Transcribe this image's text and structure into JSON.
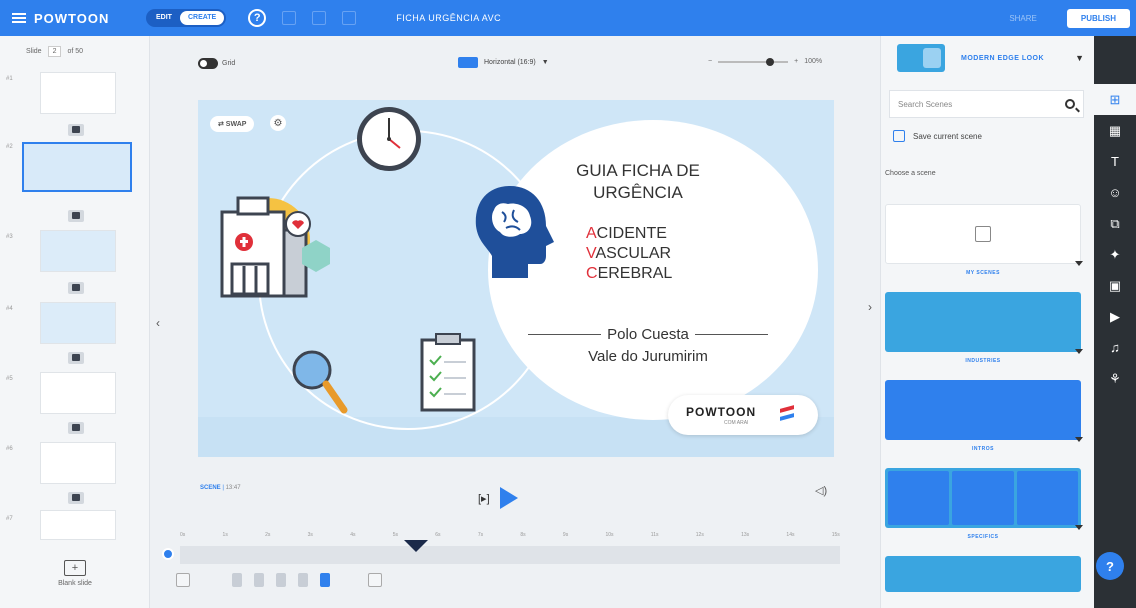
{
  "topbar": {
    "logo": "POWTOON",
    "toggle_edit": "EDIT",
    "toggle_create": "CREATE",
    "help": "?",
    "title": "FICHA URGÊNCIA AVC",
    "share": "SHARE",
    "publish": "PUBLISH",
    "accent": "#2f80ed"
  },
  "leftpanel": {
    "slide_label": "Slide",
    "slide_selected": "2",
    "slide_of": "of 50",
    "slide_numbers": [
      "#1",
      "#2",
      "#3",
      "#4",
      "#5",
      "#6",
      "#7"
    ],
    "blank_slide": "Blank slide"
  },
  "canvas_bar": {
    "grid_label": "Grid",
    "orientation": "Horizontal (16:9)",
    "zoom": "100%"
  },
  "slide": {
    "swap": "⇄ SWAP",
    "title_line1": "GUIA FICHA DE",
    "title_line2": "URGÊNCIA",
    "avc": [
      {
        "initial": "A",
        "rest": "CIDENTE"
      },
      {
        "initial": "V",
        "rest": "ASCULAR"
      },
      {
        "initial": "C",
        "rest": "EREBRAL"
      }
    ],
    "org_line1": "Polo Cuesta",
    "org_line2": "Vale do Jurumirim",
    "badge_brand": "POWTOON",
    "badge_sub": "COM ARAI",
    "accent_red": "#e0303a"
  },
  "timeline": {
    "scene_name": "SCENE",
    "scene_time": "13:47",
    "loop": "[▸]",
    "ticks": [
      "0s",
      "1s",
      "2s",
      "3s",
      "4s",
      "5s",
      "6s",
      "7s",
      "8s",
      "9s",
      "10s",
      "11s",
      "12s",
      "13s",
      "14s",
      "15s"
    ]
  },
  "rightpanel": {
    "look_name": "MODERN EDGE LOOK",
    "search_placeholder": "Search Scenes",
    "save_current": "Save current scene",
    "choose": "Choose a scene",
    "categories": [
      "MY SCENES",
      "INDUSTRIES",
      "INTROS",
      "SPECIFICS"
    ]
  },
  "toolbar": {
    "icons": [
      "layout-icon",
      "pattern-icon",
      "text-icon",
      "character-icon",
      "props-icon",
      "shapes-icon",
      "media-icon",
      "video-icon",
      "music-icon",
      "special-icon"
    ]
  },
  "help_fab": "?"
}
